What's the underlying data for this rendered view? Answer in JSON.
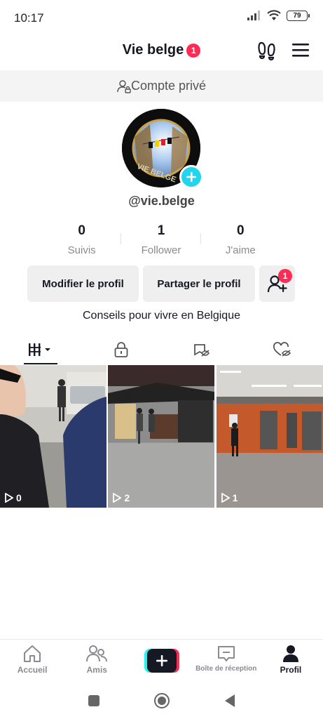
{
  "status_bar": {
    "time": "10:17",
    "battery": "79"
  },
  "header": {
    "title": "Vie belge",
    "notification_count": "1"
  },
  "private_banner": {
    "text": "Compte privé"
  },
  "profile": {
    "username": "@vie.belge",
    "bio": "Conseils pour vivre en Belgique"
  },
  "stats": [
    {
      "value": "0",
      "label": "Suivis"
    },
    {
      "value": "1",
      "label": "Follower"
    },
    {
      "value": "0",
      "label": "J'aime"
    }
  ],
  "actions": {
    "edit_label": "Modifier le profil",
    "share_label": "Partager le profil",
    "friend_badge": "1"
  },
  "tabs": [
    {
      "icon": "grid-icon",
      "active": true
    },
    {
      "icon": "lock-icon",
      "active": false
    },
    {
      "icon": "saved-icon",
      "active": false
    },
    {
      "icon": "liked-hidden-icon",
      "active": false
    }
  ],
  "videos": [
    {
      "views": "0"
    },
    {
      "views": "2"
    },
    {
      "views": "1"
    }
  ],
  "bottom_nav": {
    "home": "Accueil",
    "friends": "Amis",
    "inbox": "Boîte de réception",
    "profile": "Profil"
  },
  "colors": {
    "accent_red": "#fe2c55",
    "accent_cyan": "#20d5ec",
    "text_primary": "#161823",
    "text_secondary": "#8a8b91"
  }
}
